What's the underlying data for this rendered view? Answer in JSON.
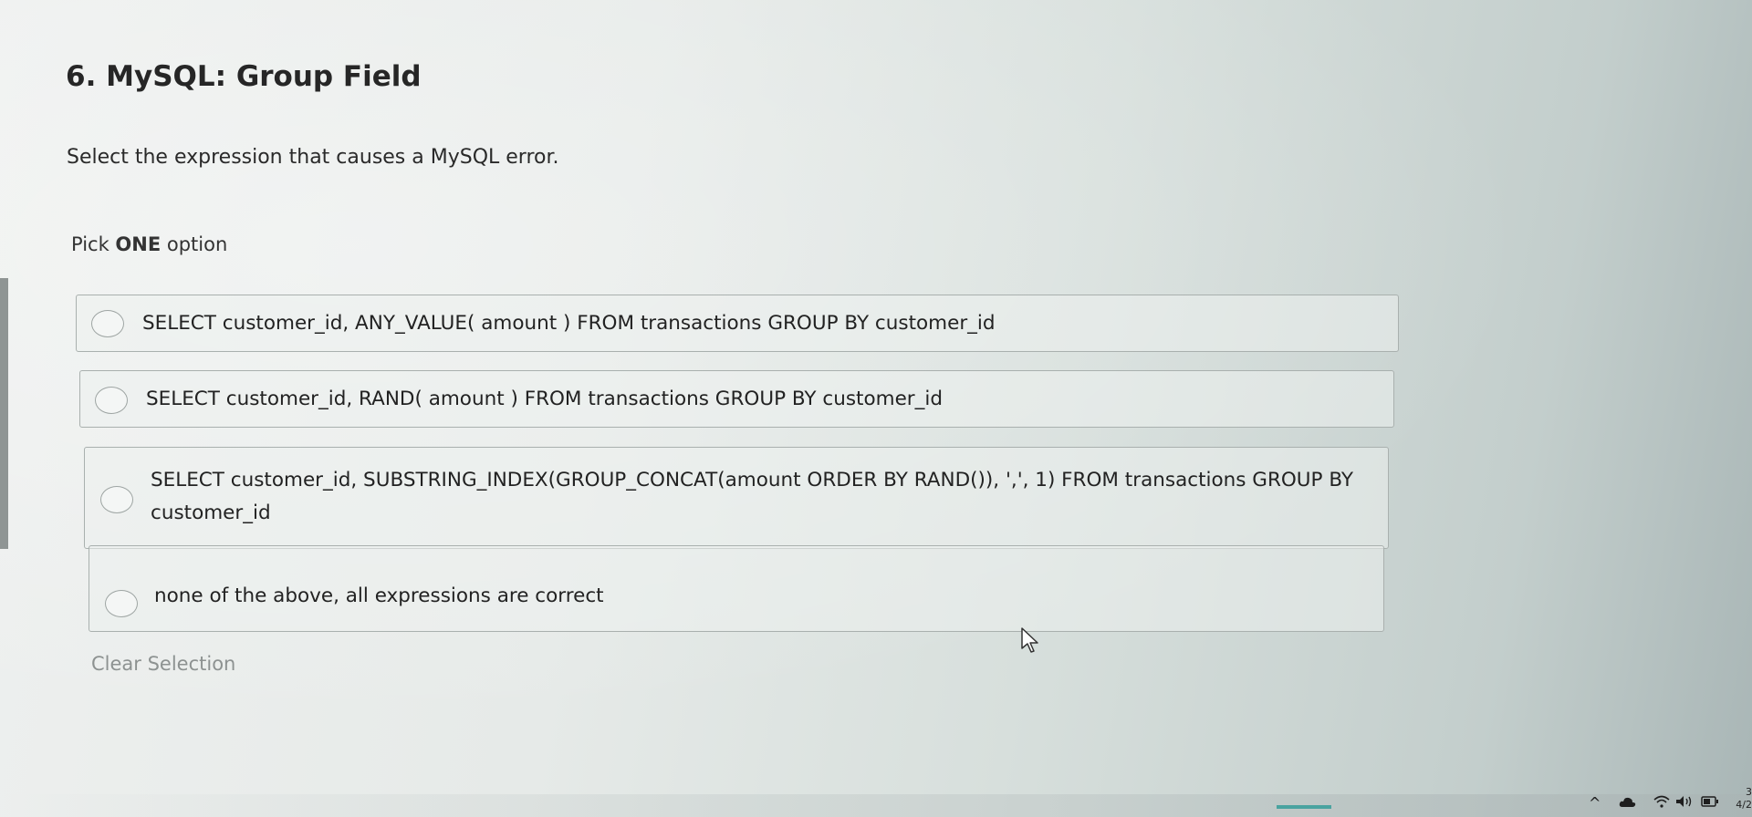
{
  "question": {
    "title": "6. MySQL: Group Field",
    "text": "Select the expression that causes a MySQL error.",
    "pick_prefix": "Pick ",
    "pick_emphasis": "ONE",
    "pick_suffix": " option"
  },
  "options": [
    {
      "label": "SELECT customer_id, ANY_VALUE( amount ) FROM transactions GROUP BY customer_id",
      "selected": false
    },
    {
      "label": "SELECT customer_id, RAND( amount ) FROM transactions GROUP BY customer_id",
      "selected": false
    },
    {
      "label": "SELECT customer_id, SUBSTRING_INDEX(GROUP_CONCAT(amount ORDER BY RAND()), ',', 1) FROM transactions GROUP BY customer_id",
      "selected": false
    },
    {
      "label": "none of the above, all expressions are correct",
      "selected": false
    }
  ],
  "clear_selection_label": "Clear Selection",
  "taskbar": {
    "icons": [
      "chevron-up-icon",
      "cloud-icon",
      "wifi-icon",
      "speaker-icon",
      "battery-icon"
    ],
    "clock_top": "3",
    "clock_bottom": "4/2"
  },
  "colors": {
    "option_border": "#a9b0ae",
    "clear_selection": "#8d9291",
    "taskbar_accent": "#4aa3a0"
  }
}
